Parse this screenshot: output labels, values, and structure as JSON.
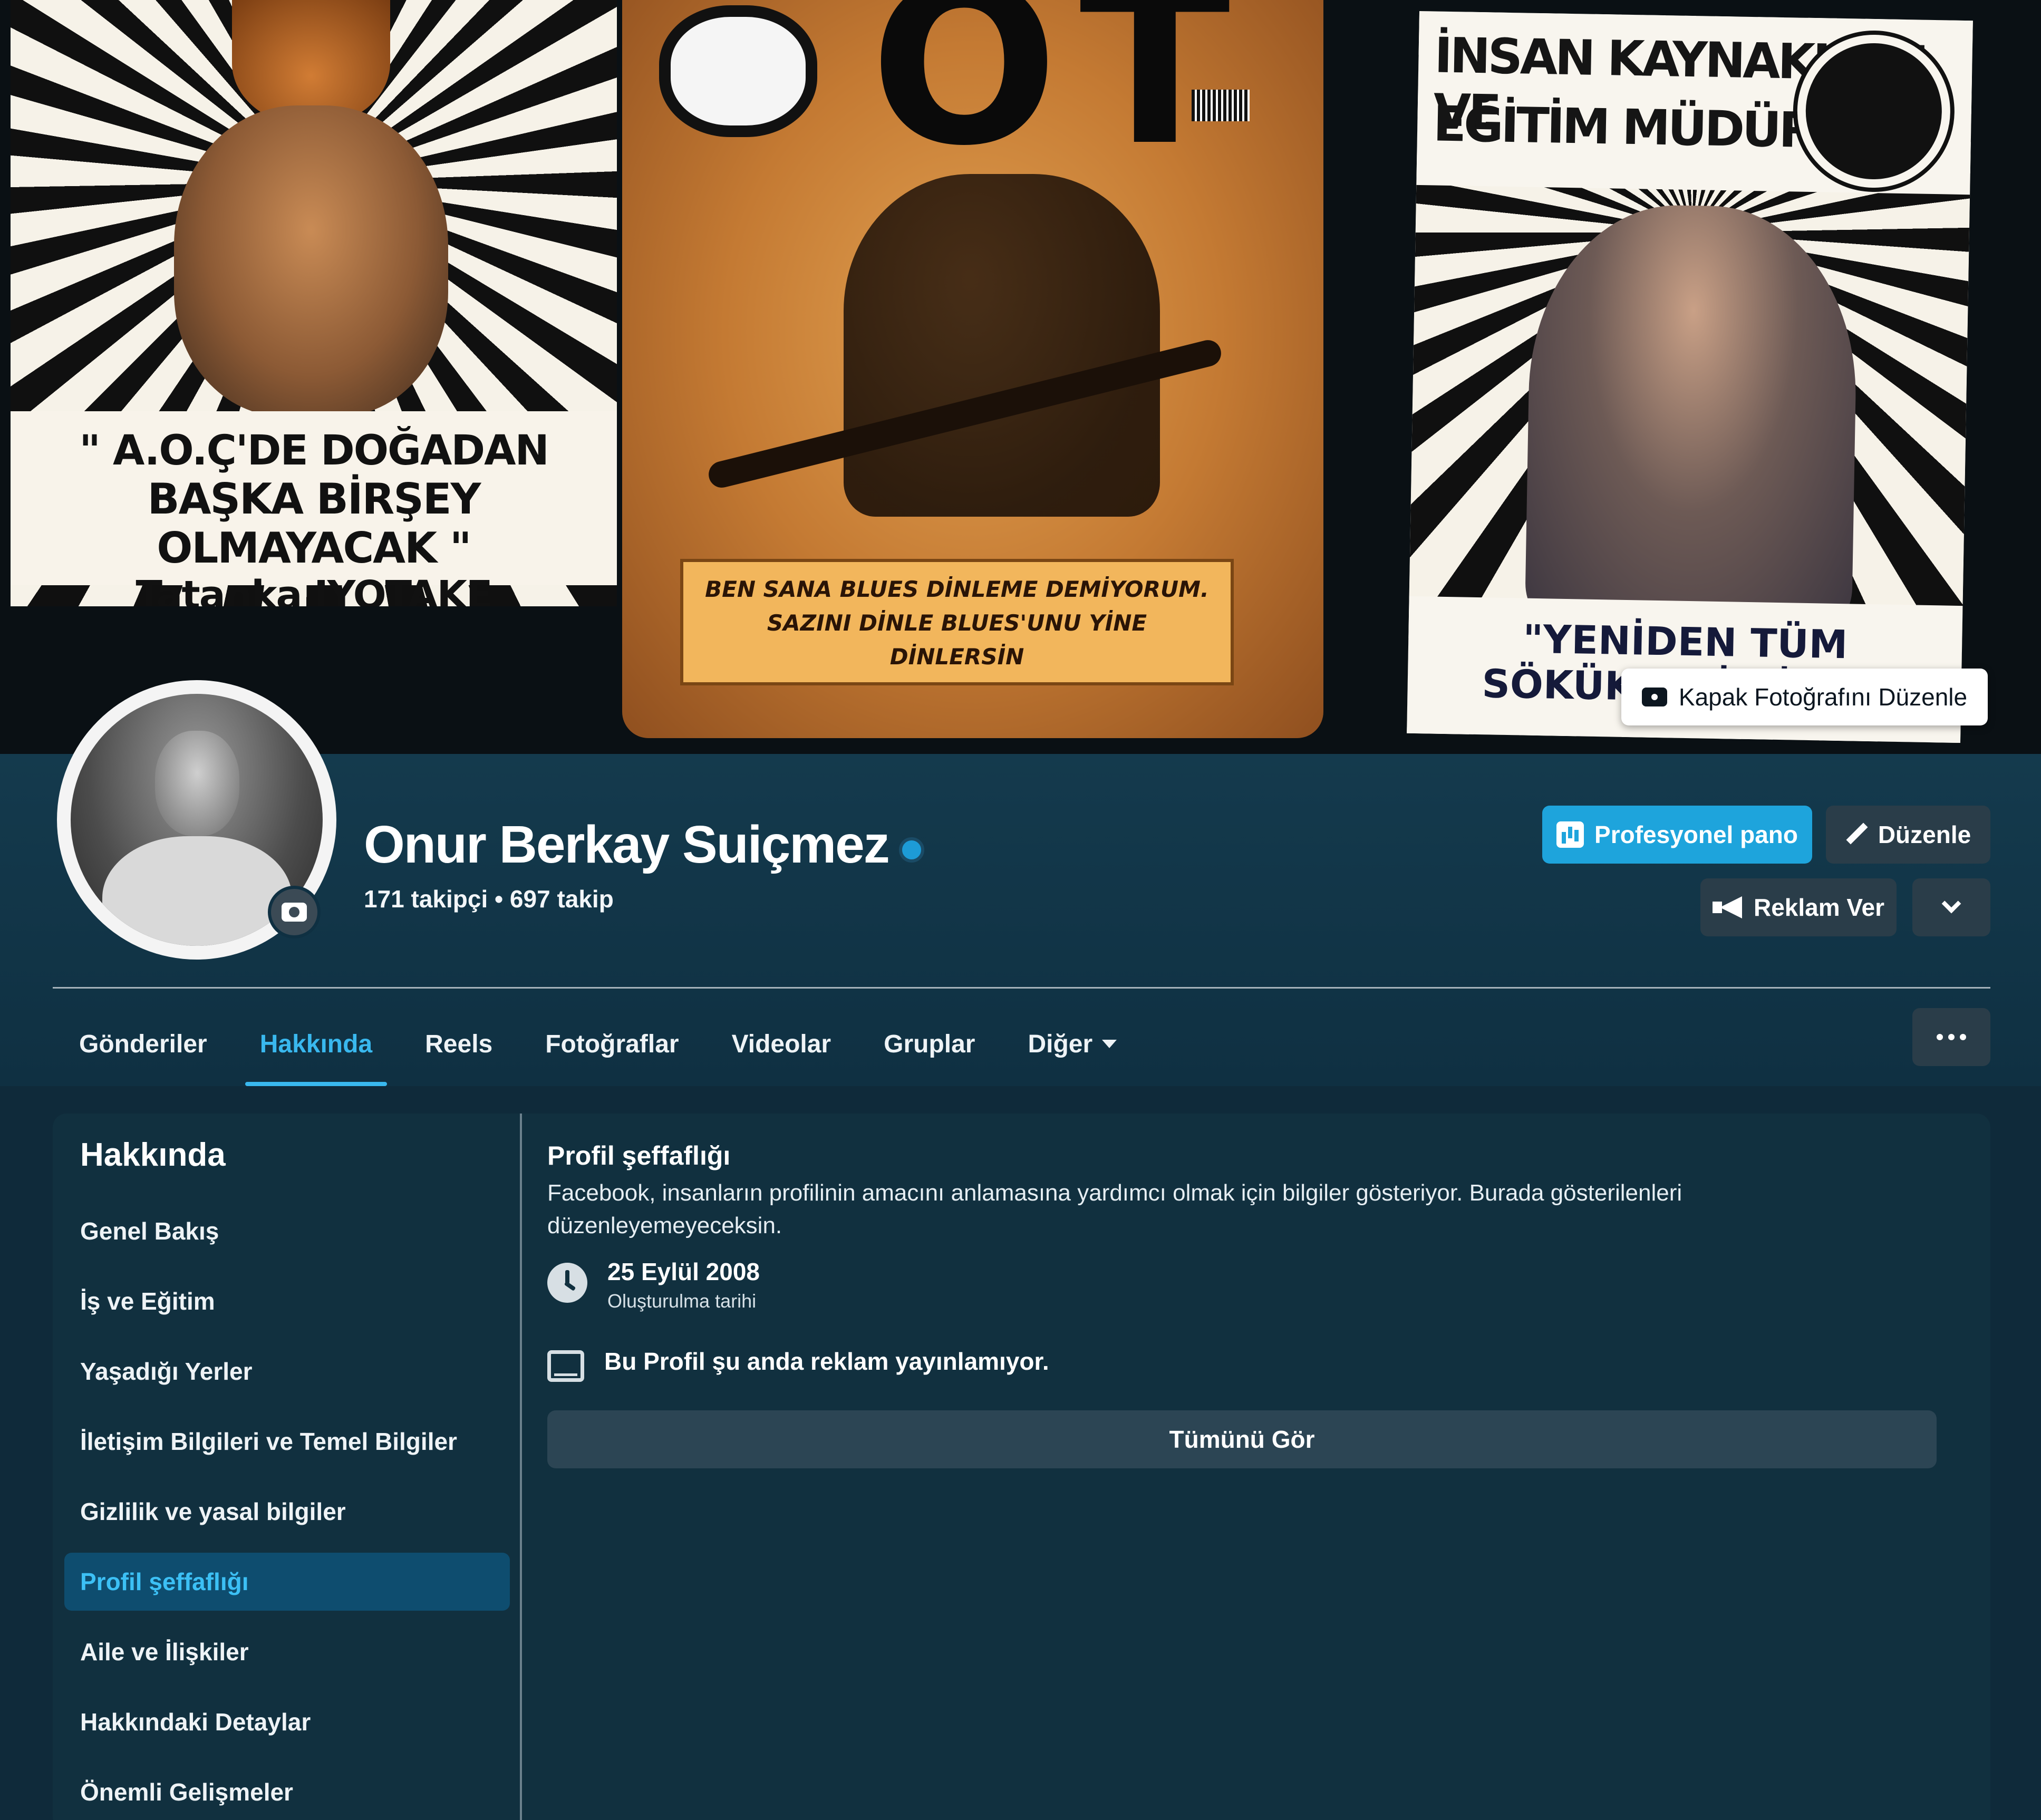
{
  "cover": {
    "edit_label": "Kapak Fotoğrafını Düzenle",
    "poster1": {
      "line1": "\" A.O.Ç'DE DOĞADAN",
      "line2": "BAŞKA BİRŞEY OLMAYACAK \"",
      "line3": "Tatanka IYOTAKE"
    },
    "poster2": {
      "title": "OT",
      "line1": "BEN SANA BLUES DİNLEME DEMİYORUM.",
      "line2": "SAZINI DİNLE BLUES'UNU YİNE",
      "line3": "DİNLERSİN"
    },
    "poster3": {
      "line1": "İNSAN KAYNAKLARI VE",
      "line2": "EĞİTİM MÜDÜRLÜĞÜ",
      "quote": "\"YENİDEN TÜM SÖKÜKLERİ DİKME"
    }
  },
  "profile": {
    "name": "Onur Berkay Suiçmez",
    "stats": "171 takipçi • 697 takip"
  },
  "actions": {
    "pro_dashboard": "Profesyonel pano",
    "edit": "Düzenle",
    "advertise": "Reklam Ver"
  },
  "tabs": [
    {
      "label": "Gönderiler"
    },
    {
      "label": "Hakkında"
    },
    {
      "label": "Reels"
    },
    {
      "label": "Fotoğraflar"
    },
    {
      "label": "Videolar"
    },
    {
      "label": "Gruplar"
    },
    {
      "label": "Diğer"
    }
  ],
  "about": {
    "title": "Hakkında",
    "items": [
      {
        "label": "Genel Bakış"
      },
      {
        "label": "İş ve Eğitim"
      },
      {
        "label": "Yaşadığı Yerler"
      },
      {
        "label": "İletişim Bilgileri ve Temel Bilgiler"
      },
      {
        "label": "Gizlilik ve yasal bilgiler"
      },
      {
        "label": "Profil şeffaflığı"
      },
      {
        "label": "Aile ve İlişkiler"
      },
      {
        "label": "Hakkındaki Detaylar"
      },
      {
        "label": "Önemli Gelişmeler"
      }
    ]
  },
  "transparency": {
    "title": "Profil şeffaflığı",
    "description": "Facebook, insanların profilinin amacını anlamasına yardımcı olmak için bilgiler gösteriyor. Burada gösterilenleri düzenleyemeyeceksin.",
    "created_date": "25 Eylül 2008",
    "created_label": "Oluşturulma tarihi",
    "ads_status": "Bu Profil şu anda reklam yayınlamıyor.",
    "see_all": "Tümünü Gör"
  },
  "colors": {
    "accent": "#1ea4dc",
    "active_tab": "#39b8ee",
    "background": "#0f2a3a",
    "button_dark": "#2a3d49"
  },
  "icons": [
    "camera-icon",
    "verified-badge-icon",
    "dashboard-icon",
    "pencil-icon",
    "megaphone-icon",
    "chevron-down-icon",
    "more-horizontal-icon",
    "clock-icon",
    "tablet-icon"
  ]
}
